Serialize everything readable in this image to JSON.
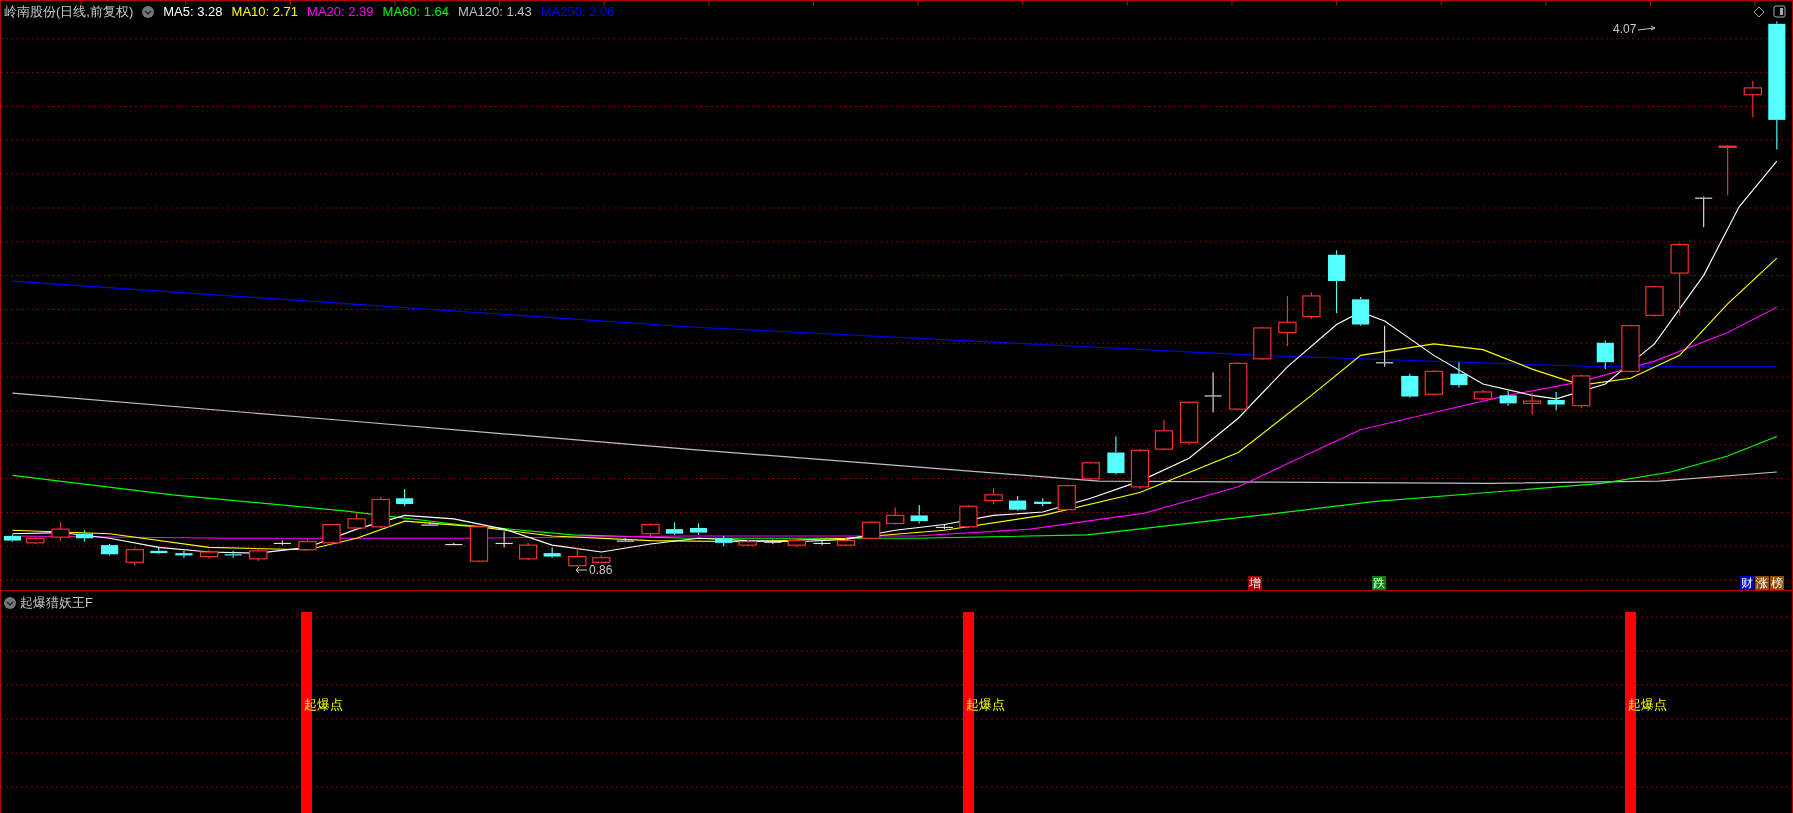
{
  "header": {
    "title": "岭南股份(日线,前复权)",
    "indicators": [
      {
        "label": "MA5: 3.28",
        "color": "#ffffff"
      },
      {
        "label": "MA10: 2.71",
        "color": "#ffff00"
      },
      {
        "label": "MA20: 2.39",
        "color": "#ff00ff"
      },
      {
        "label": "MA60: 1.64",
        "color": "#00ff00"
      },
      {
        "label": "MA120: 1.43",
        "color": "#c0c0c0"
      },
      {
        "label": "MA250: 2.06",
        "color": "#0000ff"
      }
    ]
  },
  "price_labels": {
    "high": "4.07",
    "low": "0.86"
  },
  "event_badges": [
    {
      "text": "增",
      "color": "#990000"
    },
    {
      "text": "跌",
      "color": "#008000"
    },
    {
      "text": "财",
      "color": "#0000cc"
    },
    {
      "text": "涨",
      "color": "#8a4b08"
    },
    {
      "text": "榜",
      "color": "#8a4b08"
    }
  ],
  "indicator_panel": {
    "title": "起爆猎妖王F",
    "signals": [
      {
        "label": "起爆点"
      },
      {
        "label": "起爆点"
      },
      {
        "label": "起爆点"
      }
    ]
  }
}
